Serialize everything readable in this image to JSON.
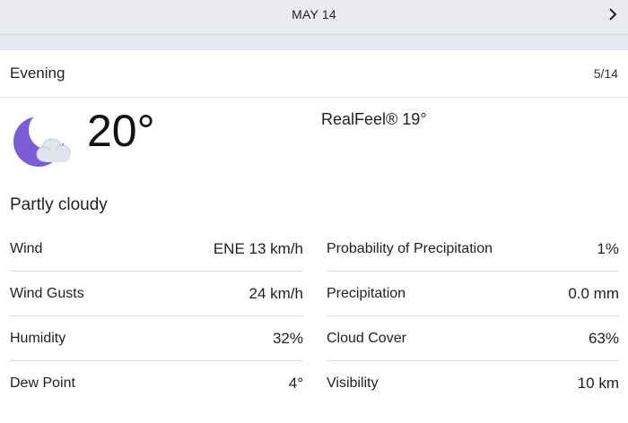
{
  "header": {
    "date": "MAY 14",
    "next_icon": "chevron-right-icon"
  },
  "period": {
    "label": "Evening",
    "date": "5/14"
  },
  "current": {
    "icon": "partly-cloudy-night-icon",
    "temperature": "20°",
    "realfeel": "RealFeel® 19°",
    "condition": "Partly cloudy"
  },
  "details": {
    "left": [
      {
        "label": "Wind",
        "value": "ENE 13 km/h"
      },
      {
        "label": "Wind Gusts",
        "value": "24 km/h"
      },
      {
        "label": "Humidity",
        "value": "32%"
      },
      {
        "label": "Dew Point",
        "value": "4°"
      }
    ],
    "right": [
      {
        "label": "Probability of Precipitation",
        "value": "1%"
      },
      {
        "label": "Precipitation",
        "value": "0.0 mm"
      },
      {
        "label": "Cloud Cover",
        "value": "63%"
      },
      {
        "label": "Visibility",
        "value": "10 km"
      }
    ]
  },
  "colors": {
    "moon": "#7b5cd6",
    "cloud": "#dfe4ee",
    "header_bg": "#e9ebef"
  }
}
